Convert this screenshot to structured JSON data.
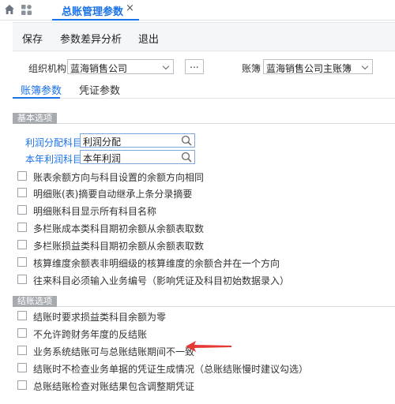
{
  "tabbar": {
    "active_tab": "总账管理参数",
    "close_glyph": "×"
  },
  "toolbar": {
    "save_label": "保存",
    "diff_label": "参数差异分析",
    "exit_label": "退出"
  },
  "org_row": {
    "org_label": "组织机构",
    "org_value": "蓝海销售公司",
    "more_label": "...",
    "ledger_label": "账簿",
    "ledger_value": "蓝海销售公司主账簿"
  },
  "subtabs": {
    "ledger_params": "账簿参数",
    "voucher_params": "凭证参数"
  },
  "basic": {
    "header": "基本选项",
    "profit_dist_label": "利润分配科目",
    "profit_dist_value": "利润分配",
    "current_profit_label": "本年利润科目",
    "current_profit_value": "本年利润",
    "options": [
      "账表余额方向与科目设置的余额方向相同",
      "明细账(表)摘要自动继承上条分录摘要",
      "明细账科目显示所有科目名称",
      "多栏账成本类科目期初余额从余额表取数",
      "多栏账损益类科目期初余额从余额表取数",
      "核算维度余额表非明细级的核算维度的余额合并在一个方向",
      "往来科目必须输入业务编号（影响凭证及科目初始数据录入）"
    ]
  },
  "closing": {
    "header": "结账选项",
    "options": [
      "结账时要求损益类科目余额为零",
      "不允许跨财务年度的反结账",
      "业务系统结账可与总账结账期间不一致",
      "结账时不检查业务单据的凭证生成情况（总账结账慢时建议勾选）",
      "总账结账检查对账结果包含调整期凭证"
    ]
  },
  "colors": {
    "accent": "#1a73e8",
    "annotation_arrow": "#e53935"
  }
}
